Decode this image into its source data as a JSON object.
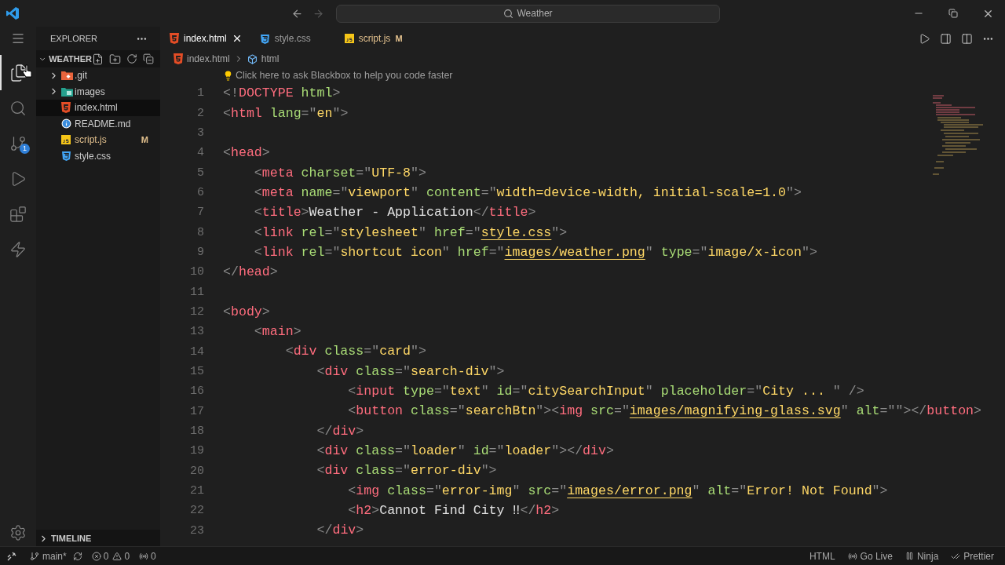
{
  "title_bar": {
    "search": "Weather"
  },
  "activity_bar": {
    "items": [
      {
        "kind": "explorer",
        "selected": true
      },
      {
        "kind": "search",
        "selected": false
      },
      {
        "kind": "source-control",
        "selected": false,
        "badge": "1"
      },
      {
        "kind": "run",
        "selected": false
      },
      {
        "kind": "extensions",
        "selected": false
      },
      {
        "kind": "lightning",
        "selected": false
      }
    ]
  },
  "sidebar": {
    "title": "EXPLORER",
    "folder": "WEATHER",
    "timeline": "TIMELINE",
    "items": [
      {
        "name": ".git",
        "kind": "git-folder",
        "expanded": false,
        "selected": false
      },
      {
        "name": "images",
        "kind": "image-folder",
        "expanded": false,
        "selected": false
      },
      {
        "name": "index.html",
        "kind": "html",
        "selected": true
      },
      {
        "name": "README.md",
        "kind": "info",
        "selected": false
      },
      {
        "name": "script.js",
        "kind": "js",
        "selected": false,
        "badge": "M"
      },
      {
        "name": "style.css",
        "kind": "css",
        "selected": false
      }
    ]
  },
  "tabs": [
    {
      "label": "index.html",
      "kind": "html",
      "selected": true
    },
    {
      "label": "style.css",
      "kind": "css",
      "selected": false
    },
    {
      "label": "script.js",
      "kind": "js",
      "selected": false,
      "badge": "M"
    }
  ],
  "breadcrumb": [
    {
      "label": "index.html",
      "kind": "html"
    },
    {
      "label": "html",
      "kind": "element"
    }
  ],
  "hint": "Click here to ask Blackbox to help you code faster",
  "code_lines": [
    {
      "number": "1",
      "tokens": [
        {
          "kind": "punct",
          "text": "<!"
        },
        {
          "kind": "tag",
          "text": "DOCTYPE"
        },
        {
          "kind": "attr",
          "text": " html"
        },
        {
          "kind": "punct",
          "text": ">"
        }
      ]
    },
    {
      "number": "2",
      "tokens": [
        {
          "kind": "punct",
          "text": "<"
        },
        {
          "kind": "tag",
          "text": "html"
        },
        {
          "kind": "attr",
          "text": " lang"
        },
        {
          "kind": "punct",
          "text": "=\""
        },
        {
          "kind": "string",
          "text": "en"
        },
        {
          "kind": "punct",
          "text": "\">"
        }
      ]
    },
    {
      "number": "3"
    },
    {
      "number": "4",
      "tokens": [
        {
          "kind": "punct",
          "text": "<"
        },
        {
          "kind": "tag",
          "text": "head"
        },
        {
          "kind": "punct",
          "text": ">"
        }
      ]
    },
    {
      "number": "5",
      "tokens": [
        {
          "kind": "punct",
          "text": "    <"
        },
        {
          "kind": "tag",
          "text": "meta"
        },
        {
          "kind": "attr",
          "text": " charset"
        },
        {
          "kind": "punct",
          "text": "=\""
        },
        {
          "kind": "string",
          "text": "UTF-8"
        },
        {
          "kind": "punct",
          "text": "\">"
        }
      ]
    },
    {
      "number": "6",
      "tokens": [
        {
          "kind": "punct",
          "text": "    <"
        },
        {
          "kind": "tag",
          "text": "meta"
        },
        {
          "kind": "attr",
          "text": " name"
        },
        {
          "kind": "punct",
          "text": "=\""
        },
        {
          "kind": "string",
          "text": "viewport"
        },
        {
          "kind": "punct",
          "text": "\""
        },
        {
          "kind": "attr",
          "text": " content"
        },
        {
          "kind": "punct",
          "text": "=\""
        },
        {
          "kind": "string",
          "text": "width=device-width, initial-scale=1.0"
        },
        {
          "kind": "punct",
          "text": "\">"
        }
      ]
    },
    {
      "number": "7",
      "tokens": [
        {
          "kind": "punct",
          "text": "    <"
        },
        {
          "kind": "tag",
          "text": "title"
        },
        {
          "kind": "punct",
          "text": ">"
        },
        {
          "kind": "text",
          "text": "Weather - Application"
        },
        {
          "kind": "punct",
          "text": "</"
        },
        {
          "kind": "tag",
          "text": "title"
        },
        {
          "kind": "punct",
          "text": ">"
        }
      ]
    },
    {
      "number": "8",
      "tokens": [
        {
          "kind": "punct",
          "text": "    <"
        },
        {
          "kind": "tag",
          "text": "link"
        },
        {
          "kind": "attr",
          "text": " rel"
        },
        {
          "kind": "punct",
          "text": "=\""
        },
        {
          "kind": "string",
          "text": "stylesheet"
        },
        {
          "kind": "punct",
          "text": "\""
        },
        {
          "kind": "attr",
          "text": " href"
        },
        {
          "kind": "punct",
          "text": "=\""
        },
        {
          "kind": "link",
          "text": "style.css"
        },
        {
          "kind": "punct",
          "text": "\">"
        }
      ]
    },
    {
      "number": "9",
      "tokens": [
        {
          "kind": "punct",
          "text": "    <"
        },
        {
          "kind": "tag",
          "text": "link"
        },
        {
          "kind": "attr",
          "text": " rel"
        },
        {
          "kind": "punct",
          "text": "=\""
        },
        {
          "kind": "string",
          "text": "shortcut icon"
        },
        {
          "kind": "punct",
          "text": "\""
        },
        {
          "kind": "attr",
          "text": " href"
        },
        {
          "kind": "punct",
          "text": "=\""
        },
        {
          "kind": "link",
          "text": "images/weather.png"
        },
        {
          "kind": "punct",
          "text": "\""
        },
        {
          "kind": "attr",
          "text": " type"
        },
        {
          "kind": "punct",
          "text": "=\""
        },
        {
          "kind": "string",
          "text": "image/x-icon"
        },
        {
          "kind": "punct",
          "text": "\">"
        }
      ]
    },
    {
      "number": "10",
      "tokens": [
        {
          "kind": "punct",
          "text": "</"
        },
        {
          "kind": "tag",
          "text": "head"
        },
        {
          "kind": "punct",
          "text": ">"
        }
      ]
    },
    {
      "number": "11"
    },
    {
      "number": "12",
      "tokens": [
        {
          "kind": "punct",
          "text": "<"
        },
        {
          "kind": "tag",
          "text": "body"
        },
        {
          "kind": "punct",
          "text": ">"
        }
      ]
    },
    {
      "number": "13",
      "tokens": [
        {
          "kind": "punct",
          "text": "    <"
        },
        {
          "kind": "tag",
          "text": "main"
        },
        {
          "kind": "punct",
          "text": ">"
        }
      ]
    },
    {
      "number": "14",
      "tokens": [
        {
          "kind": "punct",
          "text": "        <"
        },
        {
          "kind": "tag",
          "text": "div"
        },
        {
          "kind": "attr",
          "text": " class"
        },
        {
          "kind": "punct",
          "text": "=\""
        },
        {
          "kind": "string",
          "text": "card"
        },
        {
          "kind": "punct",
          "text": "\">"
        }
      ]
    },
    {
      "number": "15",
      "tokens": [
        {
          "kind": "punct",
          "text": "            <"
        },
        {
          "kind": "tag",
          "text": "div"
        },
        {
          "kind": "attr",
          "text": " class"
        },
        {
          "kind": "punct",
          "text": "=\""
        },
        {
          "kind": "string",
          "text": "search-div"
        },
        {
          "kind": "punct",
          "text": "\">"
        }
      ]
    },
    {
      "number": "16",
      "tokens": [
        {
          "kind": "punct",
          "text": "                <"
        },
        {
          "kind": "tag",
          "text": "input"
        },
        {
          "kind": "attr",
          "text": " type"
        },
        {
          "kind": "punct",
          "text": "=\""
        },
        {
          "kind": "string",
          "text": "text"
        },
        {
          "kind": "punct",
          "text": "\""
        },
        {
          "kind": "attr",
          "text": " id"
        },
        {
          "kind": "punct",
          "text": "=\""
        },
        {
          "kind": "string",
          "text": "citySearchInput"
        },
        {
          "kind": "punct",
          "text": "\""
        },
        {
          "kind": "attr",
          "text": " placeholder"
        },
        {
          "kind": "punct",
          "text": "=\""
        },
        {
          "kind": "string",
          "text": "City ... "
        },
        {
          "kind": "punct",
          "text": "\" />"
        }
      ]
    },
    {
      "number": "17",
      "tokens": [
        {
          "kind": "punct",
          "text": "                <"
        },
        {
          "kind": "tag",
          "text": "button"
        },
        {
          "kind": "attr",
          "text": " class"
        },
        {
          "kind": "punct",
          "text": "=\""
        },
        {
          "kind": "string",
          "text": "searchBtn"
        },
        {
          "kind": "punct",
          "text": "\"><"
        },
        {
          "kind": "tag",
          "text": "img"
        },
        {
          "kind": "attr",
          "text": " src"
        },
        {
          "kind": "punct",
          "text": "=\""
        },
        {
          "kind": "link",
          "text": "images/magnifying-glass.svg"
        },
        {
          "kind": "punct",
          "text": "\""
        },
        {
          "kind": "attr",
          "text": " alt"
        },
        {
          "kind": "punct",
          "text": "=\"\"></"
        },
        {
          "kind": "tag",
          "text": "button"
        },
        {
          "kind": "punct",
          "text": ">"
        }
      ]
    },
    {
      "number": "18",
      "tokens": [
        {
          "kind": "punct",
          "text": "            </"
        },
        {
          "kind": "tag",
          "text": "div"
        },
        {
          "kind": "punct",
          "text": ">"
        }
      ]
    },
    {
      "number": "19",
      "tokens": [
        {
          "kind": "punct",
          "text": "            <"
        },
        {
          "kind": "tag",
          "text": "div"
        },
        {
          "kind": "attr",
          "text": " class"
        },
        {
          "kind": "punct",
          "text": "=\""
        },
        {
          "kind": "string",
          "text": "loader"
        },
        {
          "kind": "punct",
          "text": "\""
        },
        {
          "kind": "attr",
          "text": " id"
        },
        {
          "kind": "punct",
          "text": "=\""
        },
        {
          "kind": "string",
          "text": "loader"
        },
        {
          "kind": "punct",
          "text": "\"></"
        },
        {
          "kind": "tag",
          "text": "div"
        },
        {
          "kind": "punct",
          "text": ">"
        }
      ]
    },
    {
      "number": "20",
      "tokens": [
        {
          "kind": "punct",
          "text": "            <"
        },
        {
          "kind": "tag",
          "text": "div"
        },
        {
          "kind": "attr",
          "text": " class"
        },
        {
          "kind": "punct",
          "text": "=\""
        },
        {
          "kind": "string",
          "text": "error-div"
        },
        {
          "kind": "punct",
          "text": "\">"
        }
      ]
    },
    {
      "number": "21",
      "tokens": [
        {
          "kind": "punct",
          "text": "                <"
        },
        {
          "kind": "tag",
          "text": "img"
        },
        {
          "kind": "attr",
          "text": " class"
        },
        {
          "kind": "punct",
          "text": "=\""
        },
        {
          "kind": "string",
          "text": "error-img"
        },
        {
          "kind": "punct",
          "text": "\""
        },
        {
          "kind": "attr",
          "text": " src"
        },
        {
          "kind": "punct",
          "text": "=\""
        },
        {
          "kind": "link",
          "text": "images/error.png"
        },
        {
          "kind": "punct",
          "text": "\""
        },
        {
          "kind": "attr",
          "text": " alt"
        },
        {
          "kind": "punct",
          "text": "=\""
        },
        {
          "kind": "string",
          "text": "Error! Not Found"
        },
        {
          "kind": "punct",
          "text": "\">"
        }
      ]
    },
    {
      "number": "22",
      "tokens": [
        {
          "kind": "punct",
          "text": "                <"
        },
        {
          "kind": "tag",
          "text": "h2"
        },
        {
          "kind": "punct",
          "text": ">"
        },
        {
          "kind": "text",
          "text": "Cannot Find City ‼"
        },
        {
          "kind": "punct",
          "text": "</"
        },
        {
          "kind": "tag",
          "text": "h2"
        },
        {
          "kind": "punct",
          "text": ">"
        }
      ]
    },
    {
      "number": "23",
      "tokens": [
        {
          "kind": "punct",
          "text": "            </"
        },
        {
          "kind": "tag",
          "text": "div"
        },
        {
          "kind": "punct",
          "text": ">"
        }
      ]
    }
  ],
  "status_bar": {
    "branch": "main*",
    "errors": "0",
    "warnings": "0",
    "ports": "0",
    "right": [
      {
        "kind": "language",
        "text": "HTML"
      },
      {
        "kind": "go-live",
        "text": "Go Live"
      },
      {
        "kind": "ninja",
        "text": "Ninja"
      },
      {
        "kind": "prettier",
        "text": "Prettier"
      }
    ]
  }
}
